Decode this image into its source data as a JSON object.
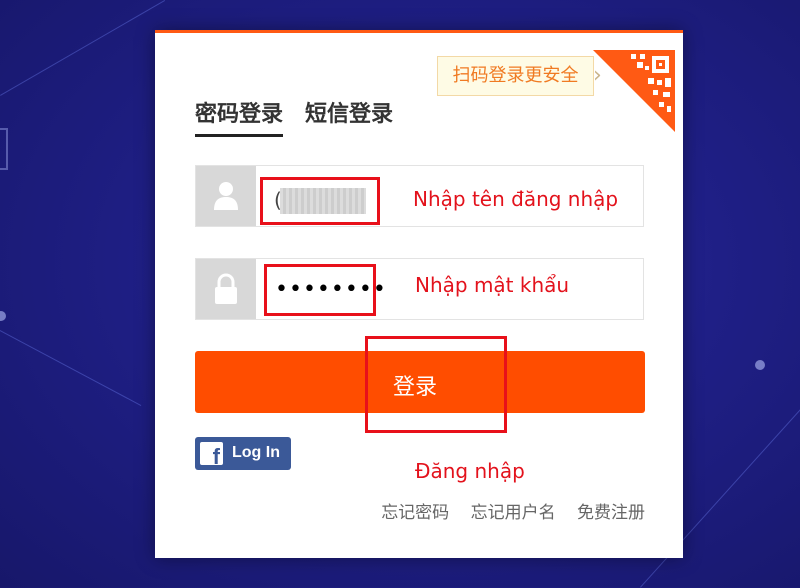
{
  "qr_tip": {
    "text": "扫码登录更安全",
    "arrow": "›",
    "icon": "qr-code-icon"
  },
  "tabs": [
    {
      "label": "密码登录",
      "active": true
    },
    {
      "label": "短信登录",
      "active": false
    }
  ],
  "username_field": {
    "icon": "user-icon",
    "caret": "("
  },
  "password_field": {
    "icon": "lock-icon",
    "masked_value": "••••••••"
  },
  "annotations": {
    "username": "Nhập tên đăng nhập",
    "password": "Nhập mật khẩu",
    "login": "Đăng nhập"
  },
  "login_button": {
    "label": "登录"
  },
  "facebook_button": {
    "logo": "f",
    "label": "Log In"
  },
  "footer_links": [
    "忘记密码",
    "忘记用户名",
    "免费注册"
  ],
  "colors": {
    "accent": "#ff4d00",
    "annotation_red": "#e3121c",
    "facebook": "#3b5998",
    "background": "#1f1f86"
  }
}
